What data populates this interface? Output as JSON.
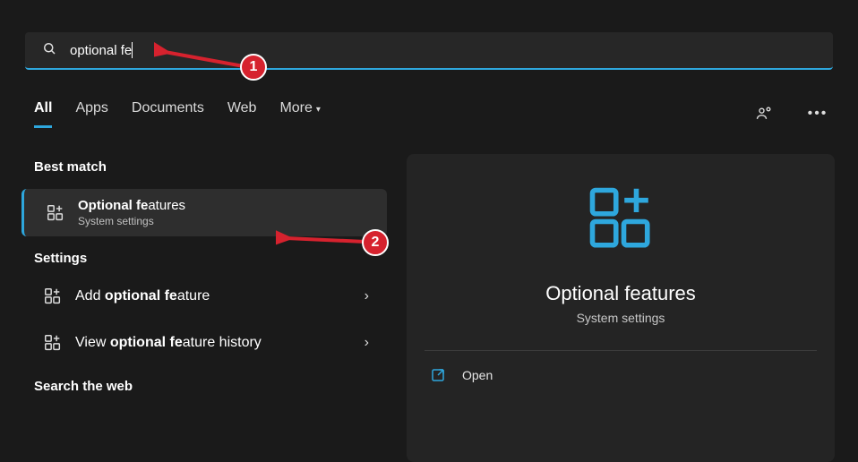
{
  "search": {
    "value": "optional fe"
  },
  "tabs": {
    "all": "All",
    "apps": "Apps",
    "documents": "Documents",
    "web": "Web",
    "more": "More"
  },
  "headers": {
    "best_match": "Best match",
    "settings": "Settings",
    "search_web": "Search the web"
  },
  "best_match": {
    "title_pre": "Optional ",
    "title_bold": "fe",
    "title_post": "atures",
    "sub": "System settings"
  },
  "settings_items": {
    "add": {
      "pre": "Add ",
      "b1": "optional",
      "mid": " ",
      "b2": "fe",
      "post": "ature"
    },
    "hist": {
      "pre": "View ",
      "b1": "optional",
      "mid": " ",
      "b2": "fe",
      "post": "ature history"
    }
  },
  "preview": {
    "title": "Optional features",
    "sub": "System settings",
    "open": "Open"
  },
  "callouts": {
    "one": "1",
    "two": "2"
  },
  "colors": {
    "accent": "#2ea7dd"
  }
}
